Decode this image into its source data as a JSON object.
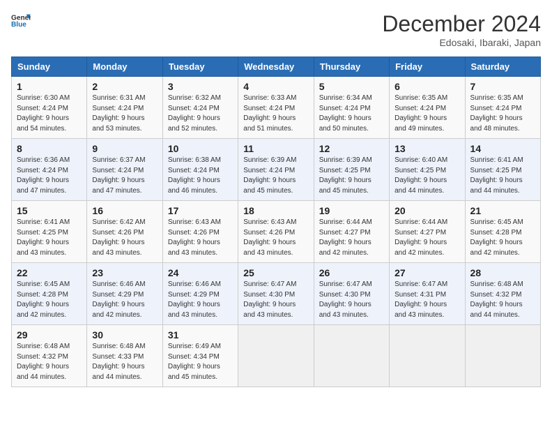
{
  "logo": {
    "line1": "General",
    "line2": "Blue"
  },
  "title": "December 2024",
  "location": "Edosaki, Ibaraki, Japan",
  "days_of_week": [
    "Sunday",
    "Monday",
    "Tuesday",
    "Wednesday",
    "Thursday",
    "Friday",
    "Saturday"
  ],
  "weeks": [
    [
      {
        "day": "1",
        "sunrise": "6:30 AM",
        "sunset": "4:24 PM",
        "daylight": "9 hours and 54 minutes."
      },
      {
        "day": "2",
        "sunrise": "6:31 AM",
        "sunset": "4:24 PM",
        "daylight": "9 hours and 53 minutes."
      },
      {
        "day": "3",
        "sunrise": "6:32 AM",
        "sunset": "4:24 PM",
        "daylight": "9 hours and 52 minutes."
      },
      {
        "day": "4",
        "sunrise": "6:33 AM",
        "sunset": "4:24 PM",
        "daylight": "9 hours and 51 minutes."
      },
      {
        "day": "5",
        "sunrise": "6:34 AM",
        "sunset": "4:24 PM",
        "daylight": "9 hours and 50 minutes."
      },
      {
        "day": "6",
        "sunrise": "6:35 AM",
        "sunset": "4:24 PM",
        "daylight": "9 hours and 49 minutes."
      },
      {
        "day": "7",
        "sunrise": "6:35 AM",
        "sunset": "4:24 PM",
        "daylight": "9 hours and 48 minutes."
      }
    ],
    [
      {
        "day": "8",
        "sunrise": "6:36 AM",
        "sunset": "4:24 PM",
        "daylight": "9 hours and 47 minutes."
      },
      {
        "day": "9",
        "sunrise": "6:37 AM",
        "sunset": "4:24 PM",
        "daylight": "9 hours and 47 minutes."
      },
      {
        "day": "10",
        "sunrise": "6:38 AM",
        "sunset": "4:24 PM",
        "daylight": "9 hours and 46 minutes."
      },
      {
        "day": "11",
        "sunrise": "6:39 AM",
        "sunset": "4:24 PM",
        "daylight": "9 hours and 45 minutes."
      },
      {
        "day": "12",
        "sunrise": "6:39 AM",
        "sunset": "4:25 PM",
        "daylight": "9 hours and 45 minutes."
      },
      {
        "day": "13",
        "sunrise": "6:40 AM",
        "sunset": "4:25 PM",
        "daylight": "9 hours and 44 minutes."
      },
      {
        "day": "14",
        "sunrise": "6:41 AM",
        "sunset": "4:25 PM",
        "daylight": "9 hours and 44 minutes."
      }
    ],
    [
      {
        "day": "15",
        "sunrise": "6:41 AM",
        "sunset": "4:25 PM",
        "daylight": "9 hours and 43 minutes."
      },
      {
        "day": "16",
        "sunrise": "6:42 AM",
        "sunset": "4:26 PM",
        "daylight": "9 hours and 43 minutes."
      },
      {
        "day": "17",
        "sunrise": "6:43 AM",
        "sunset": "4:26 PM",
        "daylight": "9 hours and 43 minutes."
      },
      {
        "day": "18",
        "sunrise": "6:43 AM",
        "sunset": "4:26 PM",
        "daylight": "9 hours and 43 minutes."
      },
      {
        "day": "19",
        "sunrise": "6:44 AM",
        "sunset": "4:27 PM",
        "daylight": "9 hours and 42 minutes."
      },
      {
        "day": "20",
        "sunrise": "6:44 AM",
        "sunset": "4:27 PM",
        "daylight": "9 hours and 42 minutes."
      },
      {
        "day": "21",
        "sunrise": "6:45 AM",
        "sunset": "4:28 PM",
        "daylight": "9 hours and 42 minutes."
      }
    ],
    [
      {
        "day": "22",
        "sunrise": "6:45 AM",
        "sunset": "4:28 PM",
        "daylight": "9 hours and 42 minutes."
      },
      {
        "day": "23",
        "sunrise": "6:46 AM",
        "sunset": "4:29 PM",
        "daylight": "9 hours and 42 minutes."
      },
      {
        "day": "24",
        "sunrise": "6:46 AM",
        "sunset": "4:29 PM",
        "daylight": "9 hours and 43 minutes."
      },
      {
        "day": "25",
        "sunrise": "6:47 AM",
        "sunset": "4:30 PM",
        "daylight": "9 hours and 43 minutes."
      },
      {
        "day": "26",
        "sunrise": "6:47 AM",
        "sunset": "4:30 PM",
        "daylight": "9 hours and 43 minutes."
      },
      {
        "day": "27",
        "sunrise": "6:47 AM",
        "sunset": "4:31 PM",
        "daylight": "9 hours and 43 minutes."
      },
      {
        "day": "28",
        "sunrise": "6:48 AM",
        "sunset": "4:32 PM",
        "daylight": "9 hours and 44 minutes."
      }
    ],
    [
      {
        "day": "29",
        "sunrise": "6:48 AM",
        "sunset": "4:32 PM",
        "daylight": "9 hours and 44 minutes."
      },
      {
        "day": "30",
        "sunrise": "6:48 AM",
        "sunset": "4:33 PM",
        "daylight": "9 hours and 44 minutes."
      },
      {
        "day": "31",
        "sunrise": "6:49 AM",
        "sunset": "4:34 PM",
        "daylight": "9 hours and 45 minutes."
      },
      null,
      null,
      null,
      null
    ]
  ],
  "labels": {
    "sunrise": "Sunrise:",
    "sunset": "Sunset:",
    "daylight": "Daylight:"
  }
}
